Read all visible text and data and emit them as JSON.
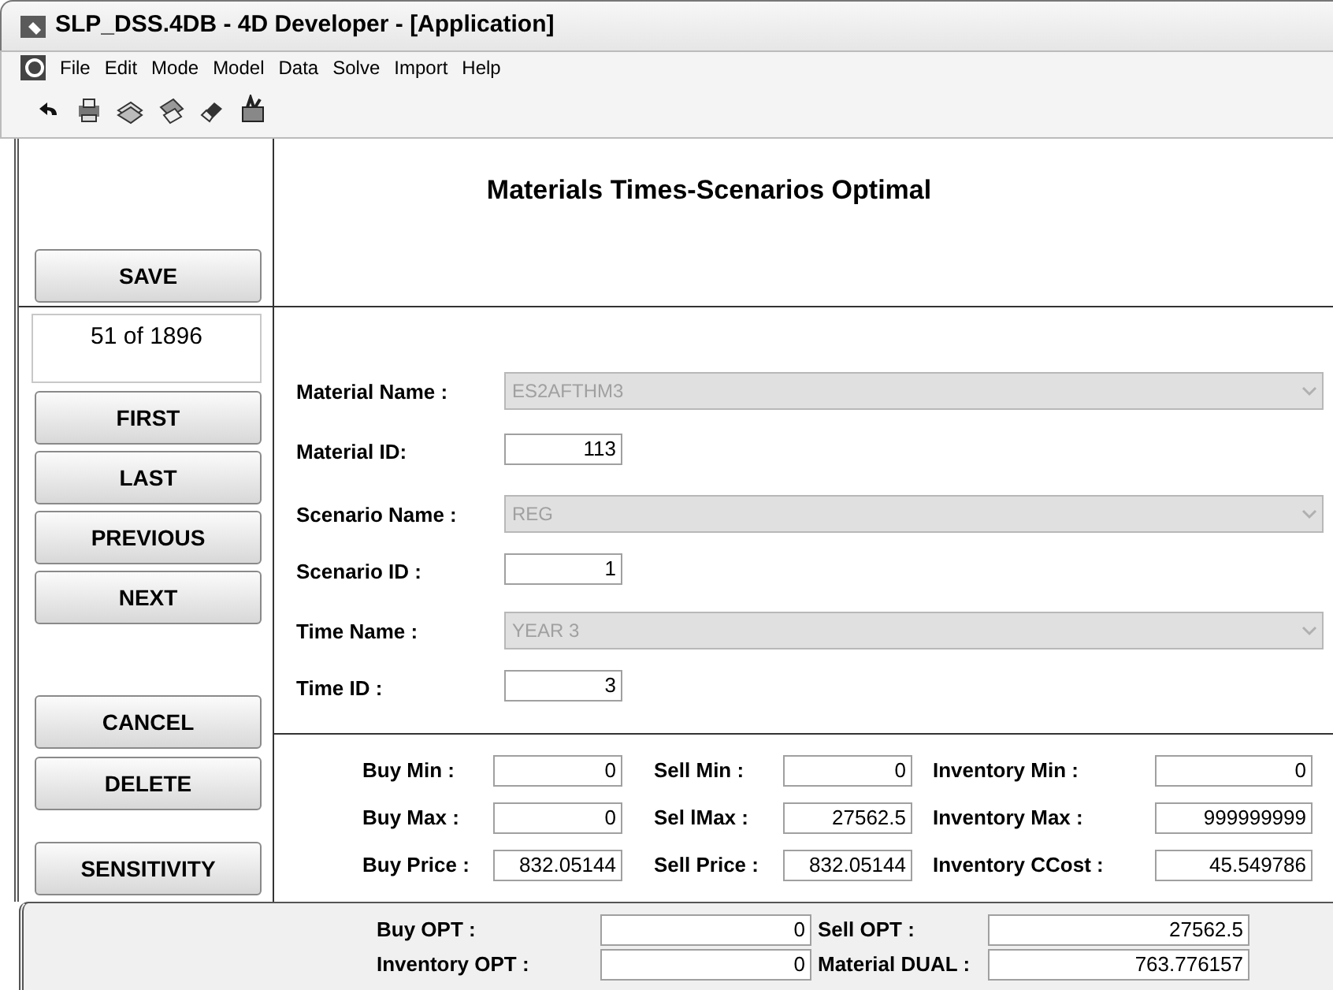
{
  "window": {
    "title": "SLP_DSS.4DB - 4D Developer - [Application]"
  },
  "menu": [
    "File",
    "Edit",
    "Mode",
    "Model",
    "Data",
    "Solve",
    "Import",
    "Help"
  ],
  "sidebar": {
    "save": "SAVE",
    "record_counter": "51 of 1896",
    "nav_buttons": [
      "FIRST",
      "LAST",
      "PREVIOUS",
      "NEXT"
    ],
    "action_buttons": [
      "CANCEL",
      "DELETE",
      "SENSITIVITY"
    ]
  },
  "form": {
    "title": "Materials Times-Scenarios Optimal",
    "fields": [
      {
        "kind": "dropdown",
        "label": "Material Name :",
        "value": "ES2AFTHM3",
        "disabled": true
      },
      {
        "kind": "number",
        "label": "Material ID:",
        "value": "113"
      },
      {
        "kind": "dropdown",
        "label": "Scenario Name :",
        "value": "REG",
        "disabled": true
      },
      {
        "kind": "number",
        "label": "Scenario ID :",
        "value": "1"
      },
      {
        "kind": "dropdown",
        "label": "Time Name :",
        "value": "YEAR 3",
        "disabled": true
      },
      {
        "kind": "number",
        "label": "Time ID :",
        "value": "3"
      }
    ],
    "limits": [
      [
        {
          "label": "Buy Min :",
          "value": "0"
        },
        {
          "label": "Sell Min :",
          "value": "0"
        },
        {
          "label": "Inventory Min :",
          "value": "0"
        }
      ],
      [
        {
          "label": "Buy Max :",
          "value": "0"
        },
        {
          "label": "Sel lMax :",
          "value": "27562.5"
        },
        {
          "label": "Inventory Max :",
          "value": "999999999"
        }
      ],
      [
        {
          "label": "Buy Price :",
          "value": "832.05144"
        },
        {
          "label": "Sell Price :",
          "value": "832.05144"
        },
        {
          "label": "Inventory CCost :",
          "value": "45.549786"
        }
      ]
    ]
  },
  "results": [
    [
      {
        "label": "Buy OPT :",
        "value": "0"
      },
      {
        "label": "Sell OPT :",
        "value": "27562.5"
      }
    ],
    [
      {
        "label": "Inventory  OPT :",
        "value": "0"
      },
      {
        "label": "Material DUAL :",
        "value": "763.776157"
      }
    ]
  ]
}
